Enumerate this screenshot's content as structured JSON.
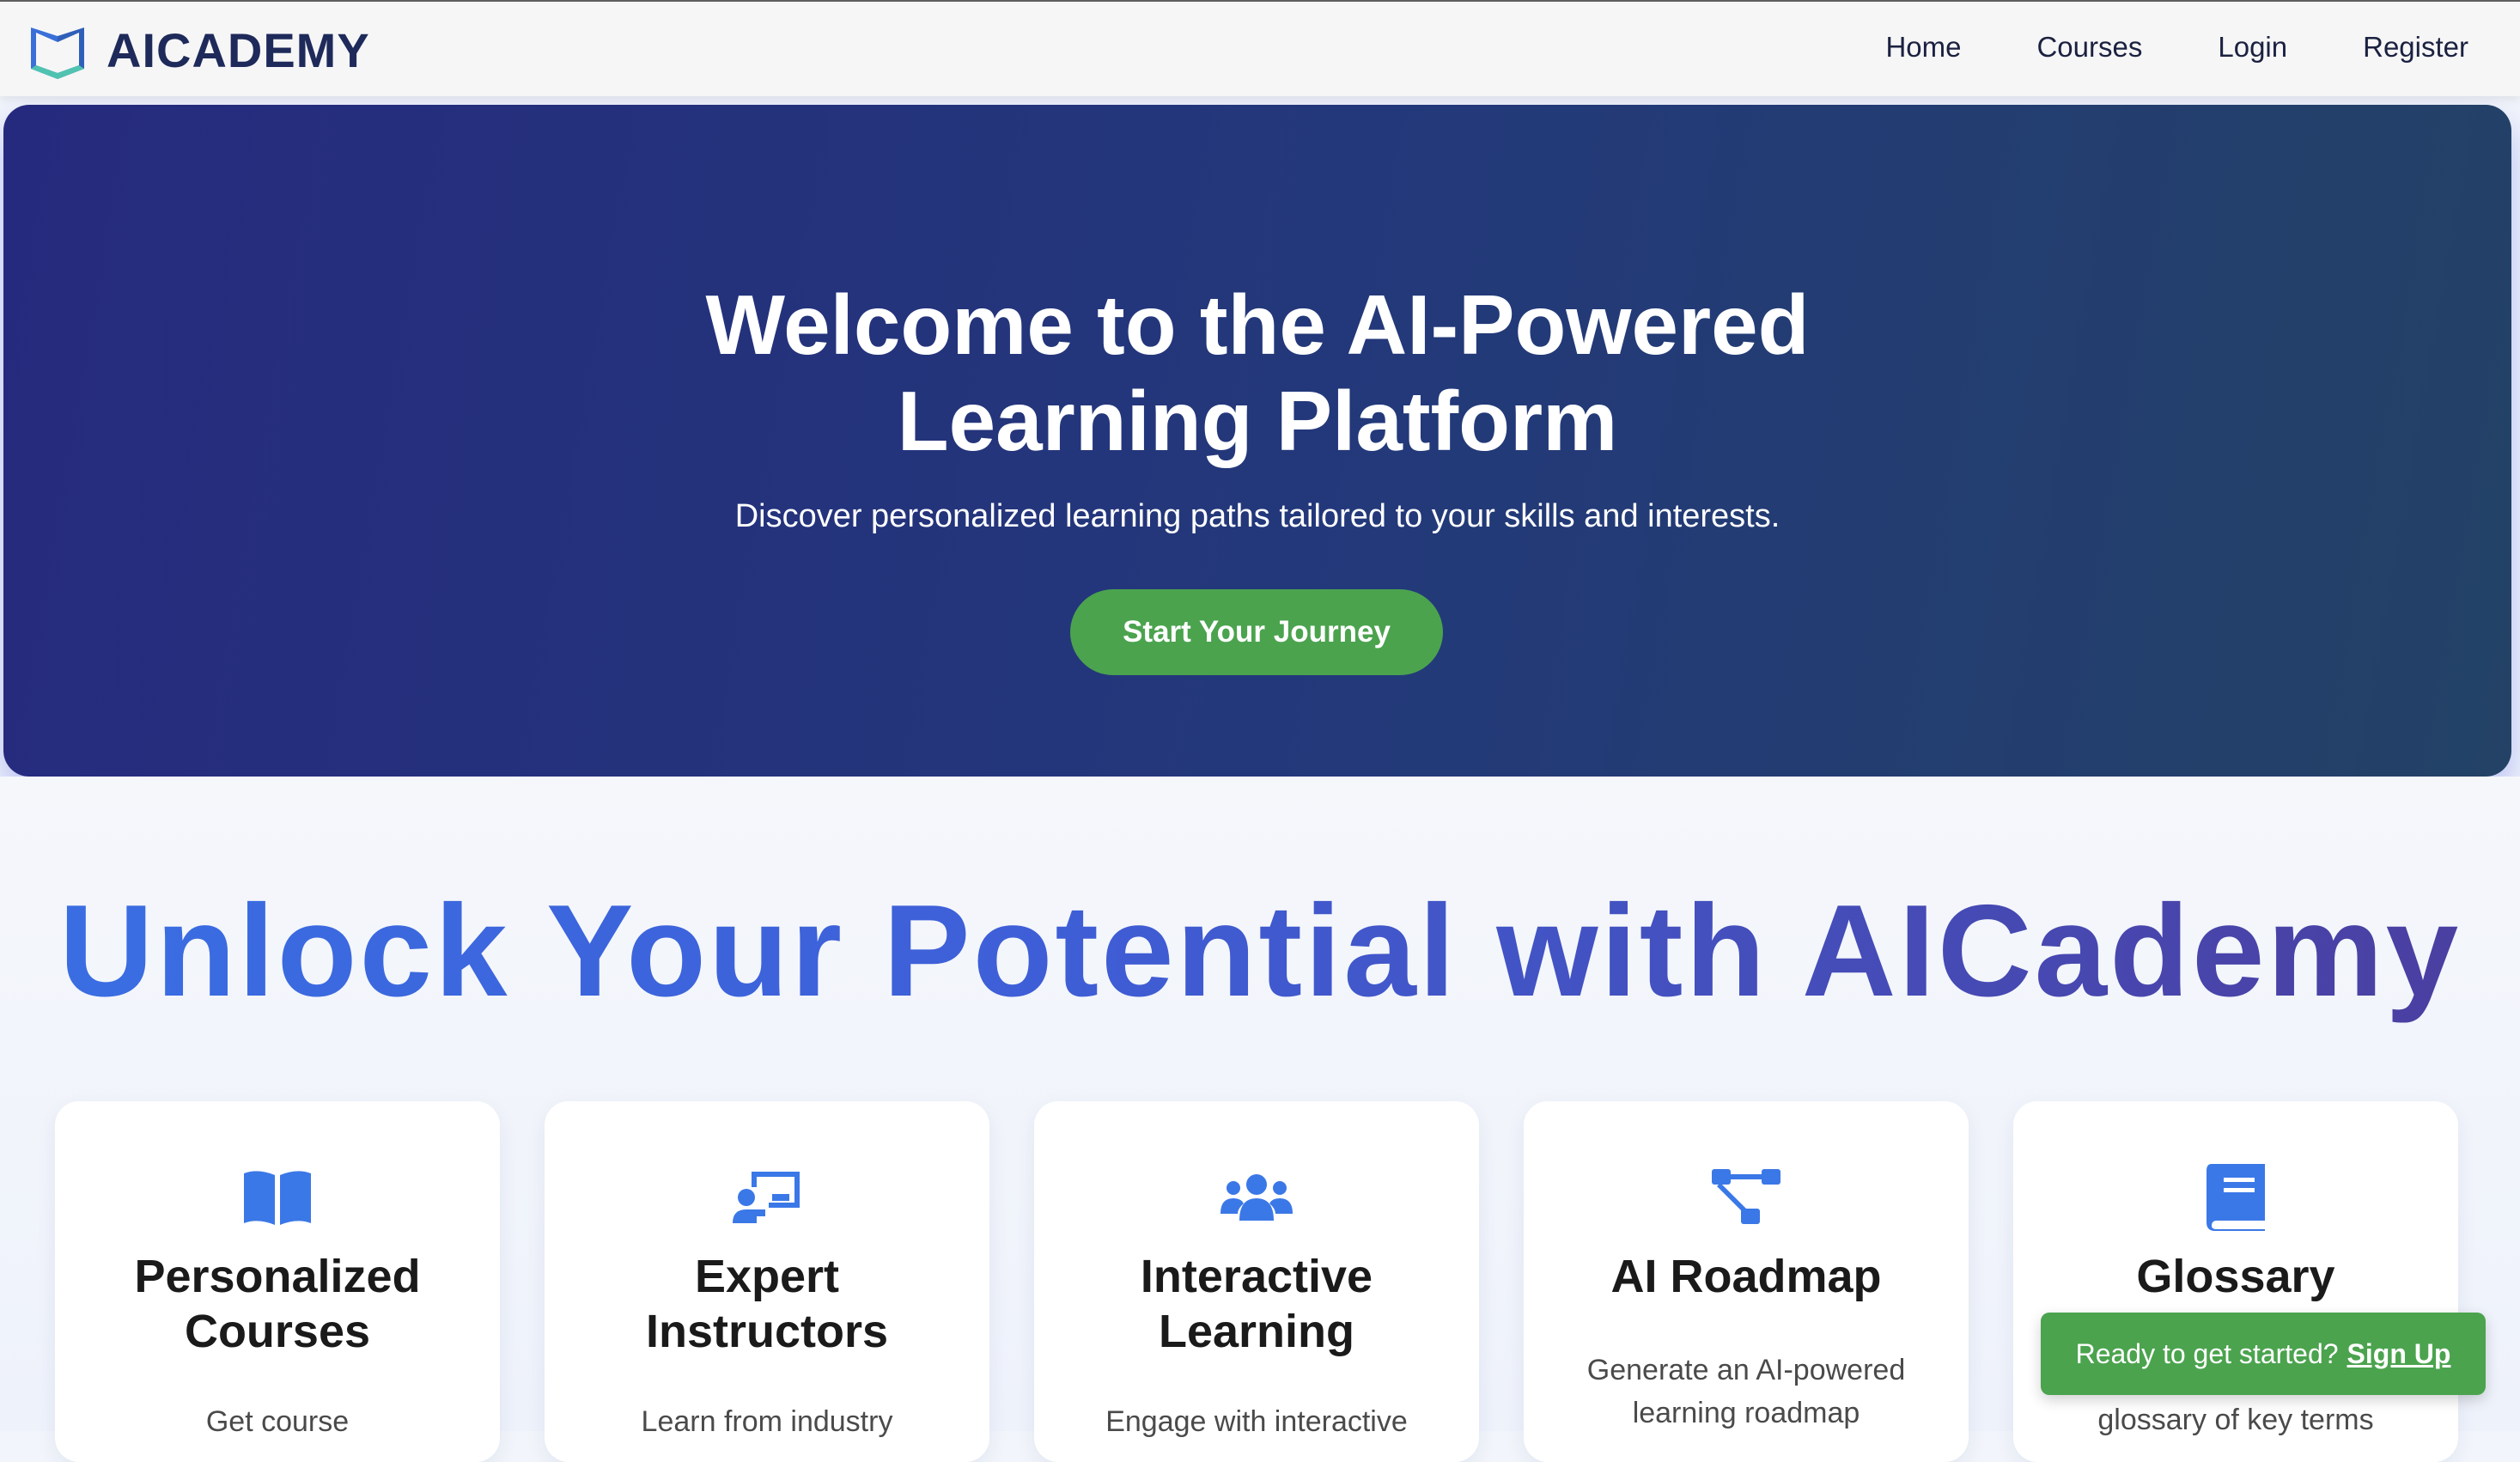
{
  "brand": {
    "name": "AICADEMY",
    "logo_icon": "open-box-logo-icon"
  },
  "nav": {
    "items": [
      {
        "label": "Home"
      },
      {
        "label": "Courses"
      },
      {
        "label": "Login"
      },
      {
        "label": "Register"
      }
    ]
  },
  "hero": {
    "title_line1": "Welcome to the AI-Powered",
    "title_line2": "Learning Platform",
    "subtitle": "Discover personalized learning paths tailored to your skills and interests.",
    "cta_label": "Start Your Journey"
  },
  "features": {
    "headline": "Unlock Your Potential with AICademy",
    "cards": [
      {
        "title_line1": "Personalized",
        "title_line2": "Courses",
        "text": "Get course",
        "icon": "open-book-icon"
      },
      {
        "title_line1": "Expert",
        "title_line2": "Instructors",
        "text": "Learn from industry",
        "icon": "teacher-board-icon"
      },
      {
        "title_line1": "Interactive",
        "title_line2": "Learning",
        "text": "Engage with interactive",
        "icon": "users-group-icon"
      },
      {
        "title_line1": "AI Roadmap",
        "title_line2": "",
        "text_line1": "Generate an AI-powered",
        "text_line2": "learning roadmap",
        "icon": "sitemap-icon"
      },
      {
        "title_line1": "Glossary",
        "title_line2": "",
        "text": "glossary of key terms",
        "icon": "book-icon"
      }
    ]
  },
  "toast": {
    "text": "Ready to get started?",
    "link_label": "Sign Up"
  },
  "colors": {
    "accent_blue": "#3b78e7",
    "cta_green": "#4ba34e",
    "hero_navy": "#262a7e"
  }
}
